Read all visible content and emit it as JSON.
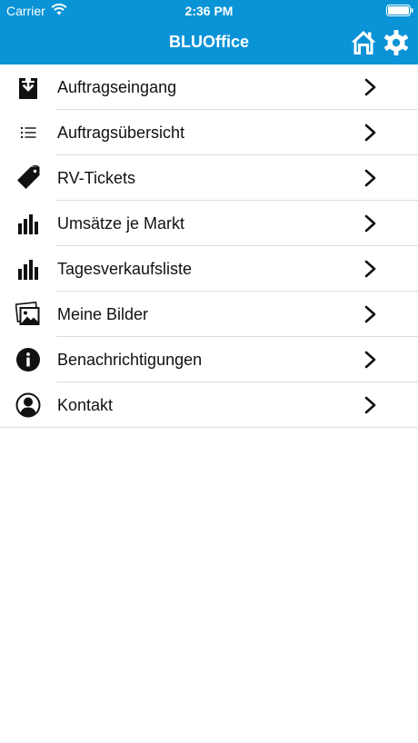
{
  "status_bar": {
    "carrier": "Carrier",
    "time": "2:36 PM"
  },
  "nav": {
    "title": "BLUOffice",
    "home_icon": "home-icon",
    "settings_icon": "gear-icon"
  },
  "colors": {
    "bar_background": "#0a93d6",
    "bar_foreground": "#ffffff",
    "text": "#111111",
    "separator": "#dcdcdc"
  },
  "menu": {
    "items": [
      {
        "label": "Auftragseingang",
        "icon": "inbox-download-icon"
      },
      {
        "label": "Auftragsübersicht",
        "icon": "list-icon"
      },
      {
        "label": "RV-Tickets",
        "icon": "tag-icon"
      },
      {
        "label": "Umsätze je Markt",
        "icon": "bar-chart-icon"
      },
      {
        "label": "Tagesverkaufsliste",
        "icon": "bar-chart-icon"
      },
      {
        "label": "Meine Bilder",
        "icon": "photos-icon"
      },
      {
        "label": "Benachrichtigungen",
        "icon": "info-icon"
      },
      {
        "label": "Kontakt",
        "icon": "user-icon"
      }
    ]
  }
}
